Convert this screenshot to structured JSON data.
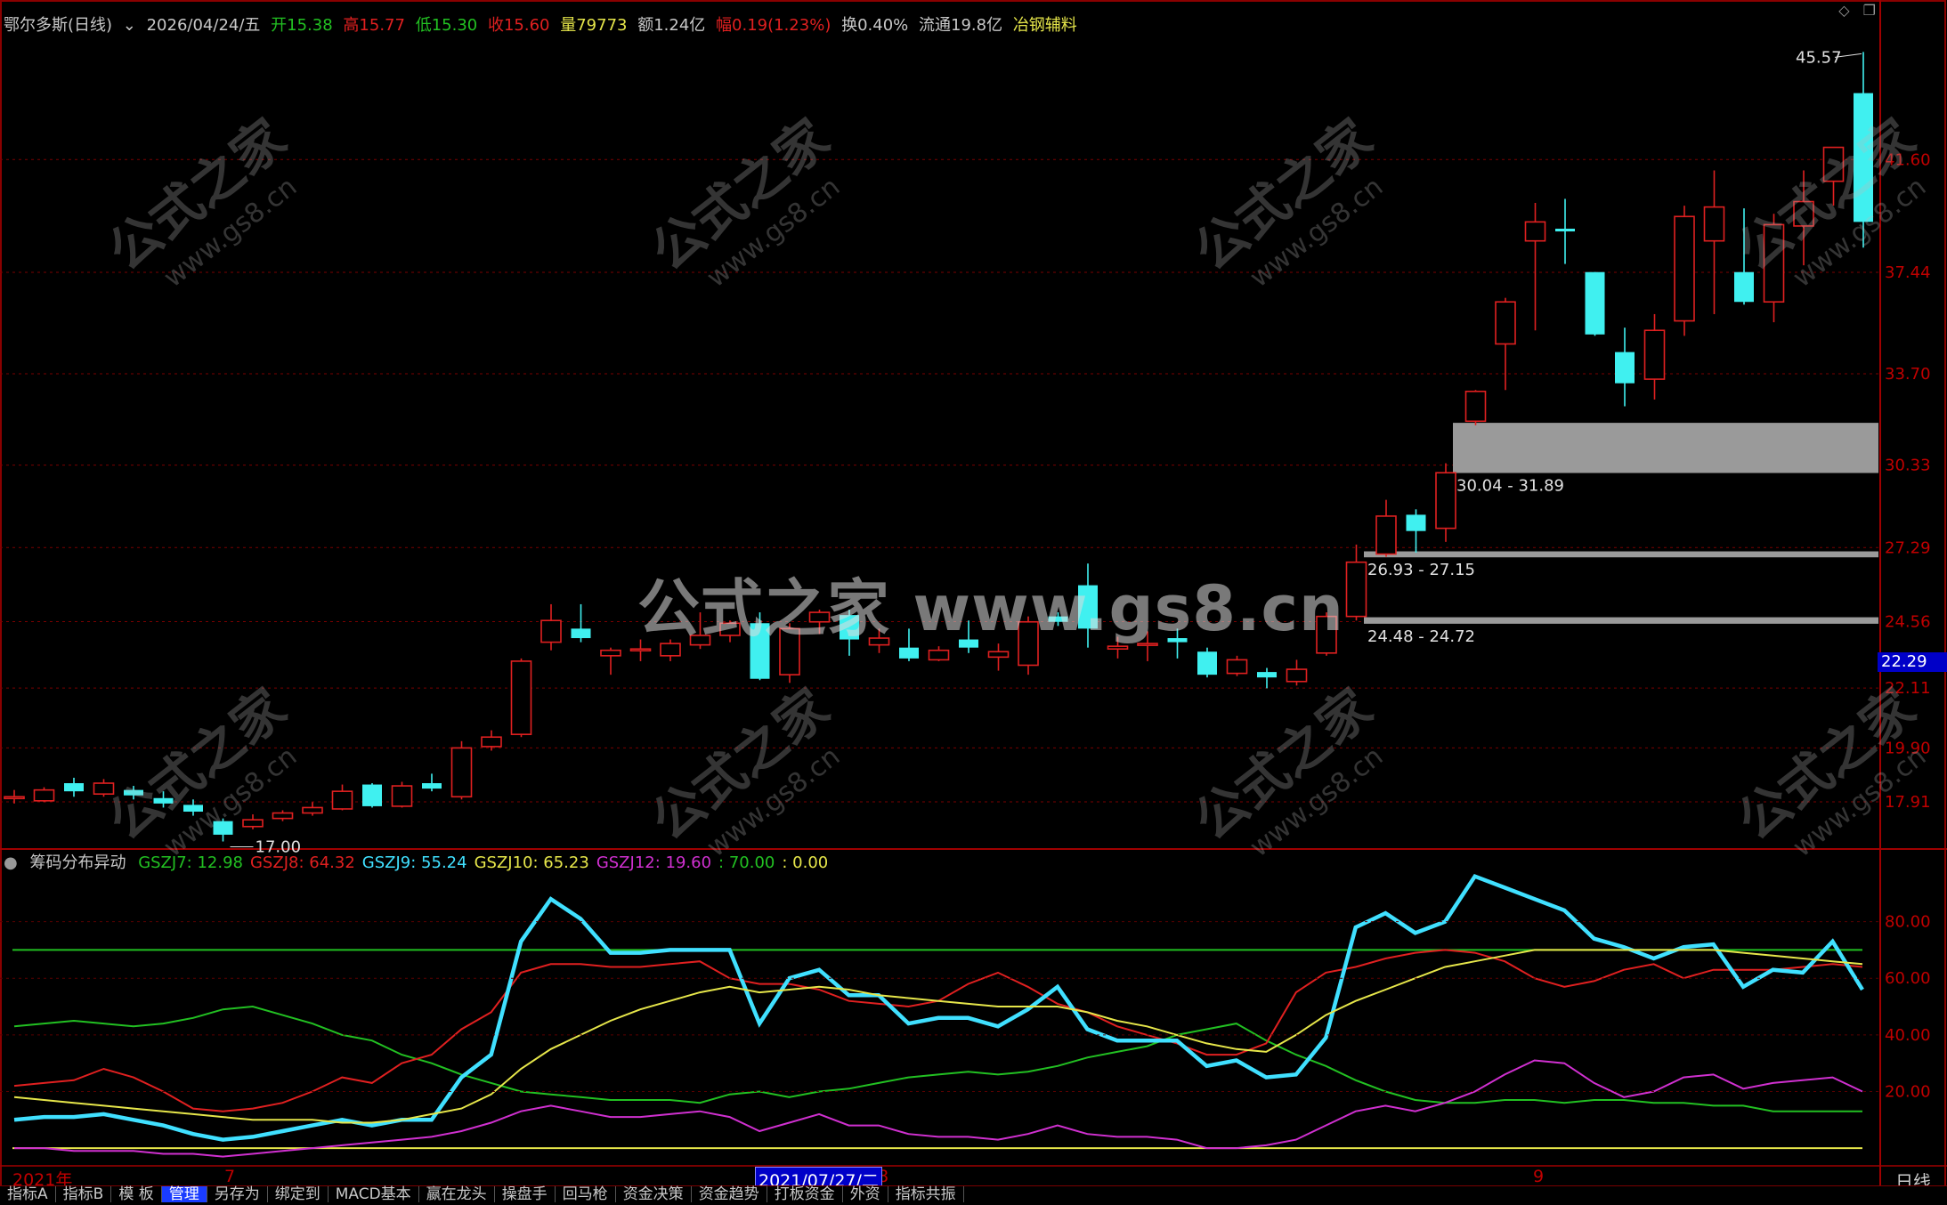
{
  "header": {
    "stock_name": "鄂尔多斯(日线)",
    "date": "2026/04/24/五",
    "open_label": "开",
    "open": "15.38",
    "high_label": "高",
    "high": "15.77",
    "low_label": "低",
    "low": "15.30",
    "close_label": "收",
    "close": "15.60",
    "volume_label": "量",
    "volume": "79773",
    "amount_label": "额",
    "amount": "1.24亿",
    "change_label": "幅",
    "change": "0.19(1.23%)",
    "turnover_label": "换",
    "turnover": "0.40%",
    "float_label": "流通",
    "float": "19.8亿",
    "sector": "冶钢辅料"
  },
  "price_axis": {
    "ticks": [
      "41.60",
      "37.44",
      "33.70",
      "30.33",
      "27.29",
      "24.56",
      "22.11",
      "19.90",
      "17.91"
    ],
    "current": "22.29"
  },
  "annotations": {
    "high_marker": "45.57",
    "low_marker": "17.00",
    "zone1": "30.04 - 31.89",
    "zone2": "26.93 - 27.15",
    "zone3": "24.48 - 24.72"
  },
  "indicator": {
    "name": "筹码分布异动",
    "items": [
      {
        "label": "GSZJ7: ",
        "value": "12.98",
        "color": "#22c022"
      },
      {
        "label": "GSZJ8: ",
        "value": "64.32",
        "color": "#e02020"
      },
      {
        "label": "GSZJ9: ",
        "value": "55.24",
        "color": "#40e0ff"
      },
      {
        "label": "GSZJ10: ",
        "value": "65.23",
        "color": "#e6e64a"
      },
      {
        "label": "GSZJ12: ",
        "value": "19.60",
        "color": "#d030d0"
      },
      {
        "label": ": ",
        "value": "70.00",
        "color": "#22c022"
      },
      {
        "label": ": ",
        "value": "0.00",
        "color": "#e6e64a"
      }
    ],
    "axis_ticks": [
      "80.00",
      "60.00",
      "40.00",
      "20.00"
    ]
  },
  "x_axis": {
    "labels": [
      "2021年",
      "7",
      "8",
      "9"
    ],
    "highlight_date": "2021/07/27/二",
    "period": "日线"
  },
  "watermark": {
    "center": "公式之家 www.gs8.cn",
    "tile_cn": "公式之家",
    "tile_url": "www.gs8.cn"
  },
  "tabs": [
    "指标A",
    "指标B",
    "模 板",
    "管理",
    "另存为",
    "绑定到",
    "MACD基本",
    "嬴在龙头",
    "操盘手",
    "回马枪",
    "资金决策",
    "资金趋势",
    "打板资金",
    "外资",
    "指标共振"
  ],
  "active_tab": "管理",
  "colors": {
    "up": "#e02020",
    "down": "#40f0f0",
    "axis_red": "#c00000",
    "zone": "#9a9a9a"
  },
  "chart_data": [
    {
      "type": "candlestick",
      "title": "鄂尔多斯(日线)",
      "ylabel": "price",
      "ylim": [
        16.5,
        46.5
      ],
      "candles": [
        {
          "o": 18.1,
          "c": 18.1,
          "h": 18.35,
          "l": 17.85
        },
        {
          "o": 17.95,
          "c": 18.35,
          "h": 18.45,
          "l": 17.9
        },
        {
          "o": 18.6,
          "c": 18.3,
          "h": 18.8,
          "l": 18.1
        },
        {
          "o": 18.2,
          "c": 18.6,
          "h": 18.75,
          "l": 18.1
        },
        {
          "o": 18.35,
          "c": 18.15,
          "h": 18.5,
          "l": 18.0
        },
        {
          "o": 18.05,
          "c": 17.85,
          "h": 18.3,
          "l": 17.7
        },
        {
          "o": 17.8,
          "c": 17.55,
          "h": 18.0,
          "l": 17.4
        },
        {
          "o": 17.2,
          "c": 16.7,
          "h": 17.3,
          "l": 16.45
        },
        {
          "o": 17.0,
          "c": 17.25,
          "h": 17.45,
          "l": 16.9
        },
        {
          "o": 17.3,
          "c": 17.5,
          "h": 17.6,
          "l": 17.2
        },
        {
          "o": 17.5,
          "c": 17.7,
          "h": 17.9,
          "l": 17.4
        },
        {
          "o": 17.65,
          "c": 18.3,
          "h": 18.55,
          "l": 17.6
        },
        {
          "o": 18.55,
          "c": 17.75,
          "h": 18.6,
          "l": 17.7
        },
        {
          "o": 17.75,
          "c": 18.5,
          "h": 18.65,
          "l": 17.7
        },
        {
          "o": 18.6,
          "c": 18.4,
          "h": 18.95,
          "l": 18.3
        },
        {
          "o": 18.1,
          "c": 19.9,
          "h": 20.15,
          "l": 18.0
        },
        {
          "o": 19.95,
          "c": 20.3,
          "h": 20.55,
          "l": 19.8
        },
        {
          "o": 20.4,
          "c": 23.1,
          "h": 23.2,
          "l": 20.3
        },
        {
          "o": 23.8,
          "c": 24.6,
          "h": 25.2,
          "l": 23.5
        },
        {
          "o": 24.3,
          "c": 23.95,
          "h": 25.2,
          "l": 23.8
        },
        {
          "o": 23.3,
          "c": 23.5,
          "h": 23.6,
          "l": 22.6
        },
        {
          "o": 23.55,
          "c": 23.55,
          "h": 23.9,
          "l": 23.1
        },
        {
          "o": 23.3,
          "c": 23.75,
          "h": 23.9,
          "l": 23.1
        },
        {
          "o": 23.7,
          "c": 24.05,
          "h": 24.9,
          "l": 23.55
        },
        {
          "o": 24.05,
          "c": 24.5,
          "h": 24.6,
          "l": 23.8
        },
        {
          "o": 24.5,
          "c": 22.45,
          "h": 24.9,
          "l": 22.4
        },
        {
          "o": 22.6,
          "c": 24.3,
          "h": 24.5,
          "l": 22.3
        },
        {
          "o": 24.55,
          "c": 24.9,
          "h": 25.0,
          "l": 24.1
        },
        {
          "o": 24.8,
          "c": 23.9,
          "h": 25.0,
          "l": 23.3
        },
        {
          "o": 23.7,
          "c": 23.95,
          "h": 24.3,
          "l": 23.4
        },
        {
          "o": 23.6,
          "c": 23.2,
          "h": 24.3,
          "l": 23.1
        },
        {
          "o": 23.15,
          "c": 23.5,
          "h": 23.65,
          "l": 23.1
        },
        {
          "o": 23.9,
          "c": 23.6,
          "h": 24.6,
          "l": 23.4
        },
        {
          "o": 23.25,
          "c": 23.45,
          "h": 23.75,
          "l": 22.75
        },
        {
          "o": 22.95,
          "c": 24.55,
          "h": 24.75,
          "l": 22.6
        },
        {
          "o": 24.75,
          "c": 24.55,
          "h": 24.9,
          "l": 24.4
        },
        {
          "o": 25.9,
          "c": 24.3,
          "h": 26.7,
          "l": 23.6
        },
        {
          "o": 23.55,
          "c": 23.65,
          "h": 24.0,
          "l": 23.2
        },
        {
          "o": 23.75,
          "c": 23.75,
          "h": 24.2,
          "l": 23.1
        },
        {
          "o": 23.95,
          "c": 23.8,
          "h": 24.3,
          "l": 23.2
        },
        {
          "o": 23.45,
          "c": 22.6,
          "h": 23.6,
          "l": 22.5
        },
        {
          "o": 22.65,
          "c": 23.15,
          "h": 23.3,
          "l": 22.55
        },
        {
          "o": 22.7,
          "c": 22.5,
          "h": 22.85,
          "l": 22.1
        },
        {
          "o": 22.35,
          "c": 22.8,
          "h": 23.15,
          "l": 22.2
        },
        {
          "o": 23.4,
          "c": 24.75,
          "h": 24.9,
          "l": 23.3
        },
        {
          "o": 24.75,
          "c": 26.75,
          "h": 27.4,
          "l": 24.6
        },
        {
          "o": 27.05,
          "c": 28.45,
          "h": 29.05,
          "l": 26.95
        },
        {
          "o": 28.5,
          "c": 27.9,
          "h": 28.7,
          "l": 27.1
        },
        {
          "o": 28.0,
          "c": 30.05,
          "h": 30.4,
          "l": 27.5
        },
        {
          "o": 31.95,
          "c": 33.05,
          "h": 33.1,
          "l": 31.8
        },
        {
          "o": 34.8,
          "c": 36.35,
          "h": 36.5,
          "l": 33.1
        },
        {
          "o": 38.6,
          "c": 39.3,
          "h": 40.0,
          "l": 35.3
        },
        {
          "o": 39.05,
          "c": 38.95,
          "h": 40.15,
          "l": 37.75
        },
        {
          "o": 37.45,
          "c": 35.15,
          "h": 37.45,
          "l": 35.1
        },
        {
          "o": 34.5,
          "c": 33.35,
          "h": 35.4,
          "l": 32.5
        },
        {
          "o": 33.5,
          "c": 35.3,
          "h": 35.9,
          "l": 32.75
        },
        {
          "o": 35.65,
          "c": 39.5,
          "h": 39.9,
          "l": 35.1
        },
        {
          "o": 38.6,
          "c": 39.85,
          "h": 41.2,
          "l": 35.9
        },
        {
          "o": 37.45,
          "c": 36.35,
          "h": 39.8,
          "l": 36.25
        },
        {
          "o": 36.35,
          "c": 39.2,
          "h": 39.6,
          "l": 35.6
        },
        {
          "o": 39.15,
          "c": 40.05,
          "h": 41.2,
          "l": 37.7
        },
        {
          "o": 40.8,
          "c": 42.05,
          "h": 42.05,
          "l": 39.9
        },
        {
          "o": 44.05,
          "c": 39.3,
          "h": 45.57,
          "l": 38.35
        }
      ]
    },
    {
      "type": "line",
      "title": "筹码分布异动",
      "ylim": [
        -5,
        100
      ],
      "hlines": [
        {
          "y": 70,
          "color": "#22c022"
        },
        {
          "y": 0,
          "color": "#e6e64a"
        }
      ],
      "series": [
        {
          "name": "GSZJ7",
          "color": "#22c022",
          "values": [
            43,
            44,
            45,
            44,
            43,
            44,
            46,
            49,
            50,
            47,
            44,
            40,
            38,
            33,
            30,
            26,
            23,
            20,
            19,
            18,
            17,
            17,
            17,
            16,
            19,
            20,
            18,
            20,
            21,
            23,
            25,
            26,
            27,
            26,
            27,
            29,
            32,
            34,
            36,
            40,
            42,
            44,
            38,
            33,
            29,
            24,
            20,
            17,
            16,
            16,
            17,
            17,
            16,
            17,
            17,
            16,
            16,
            15,
            15,
            13,
            13,
            13,
            13
          ]
        },
        {
          "name": "GSZJ8",
          "color": "#e02020",
          "values": [
            22,
            23,
            24,
            28,
            25,
            20,
            14,
            13,
            14,
            16,
            20,
            25,
            23,
            30,
            33,
            42,
            48,
            62,
            65,
            65,
            64,
            64,
            65,
            66,
            60,
            58,
            58,
            56,
            52,
            51,
            50,
            52,
            58,
            62,
            57,
            51,
            48,
            43,
            40,
            37,
            33,
            33,
            37,
            55,
            62,
            64,
            67,
            69,
            70,
            69,
            66,
            60,
            57,
            59,
            63,
            65,
            60,
            63,
            63,
            63,
            64,
            65,
            64
          ]
        },
        {
          "name": "GSZJ9",
          "color": "#40e0ff",
          "values": [
            10,
            11,
            11,
            12,
            10,
            8,
            5,
            3,
            4,
            6,
            8,
            10,
            8,
            10,
            10,
            25,
            33,
            73,
            88,
            81,
            69,
            69,
            70,
            70,
            70,
            44,
            60,
            63,
            54,
            54,
            44,
            46,
            46,
            43,
            49,
            57,
            42,
            38,
            38,
            38,
            29,
            31,
            25,
            26,
            39,
            78,
            83,
            76,
            80,
            96,
            92,
            88,
            84,
            74,
            71,
            67,
            71,
            72,
            57,
            63,
            62,
            73,
            56
          ]
        },
        {
          "name": "GSZJ10",
          "color": "#e6e64a",
          "values": [
            18,
            17,
            16,
            15,
            14,
            13,
            12,
            11,
            10,
            10,
            10,
            9,
            9,
            10,
            12,
            14,
            19,
            28,
            35,
            40,
            45,
            49,
            52,
            55,
            57,
            55,
            56,
            57,
            56,
            54,
            53,
            52,
            51,
            50,
            50,
            50,
            48,
            45,
            43,
            40,
            37,
            35,
            34,
            40,
            47,
            52,
            56,
            60,
            64,
            66,
            68,
            70,
            70,
            70,
            70,
            70,
            70,
            70,
            69,
            68,
            67,
            66,
            65
          ]
        },
        {
          "name": "GSZJ12",
          "color": "#d030d0",
          "values": [
            0,
            0,
            -1,
            -1,
            -1,
            -2,
            -2,
            -3,
            -2,
            -1,
            0,
            1,
            2,
            3,
            4,
            6,
            9,
            13,
            15,
            13,
            11,
            11,
            12,
            13,
            11,
            6,
            9,
            12,
            8,
            8,
            5,
            4,
            4,
            3,
            5,
            8,
            5,
            4,
            4,
            3,
            0,
            0,
            1,
            3,
            8,
            13,
            15,
            13,
            16,
            20,
            26,
            31,
            30,
            23,
            18,
            20,
            25,
            26,
            21,
            23,
            24,
            25,
            20
          ]
        }
      ]
    }
  ]
}
